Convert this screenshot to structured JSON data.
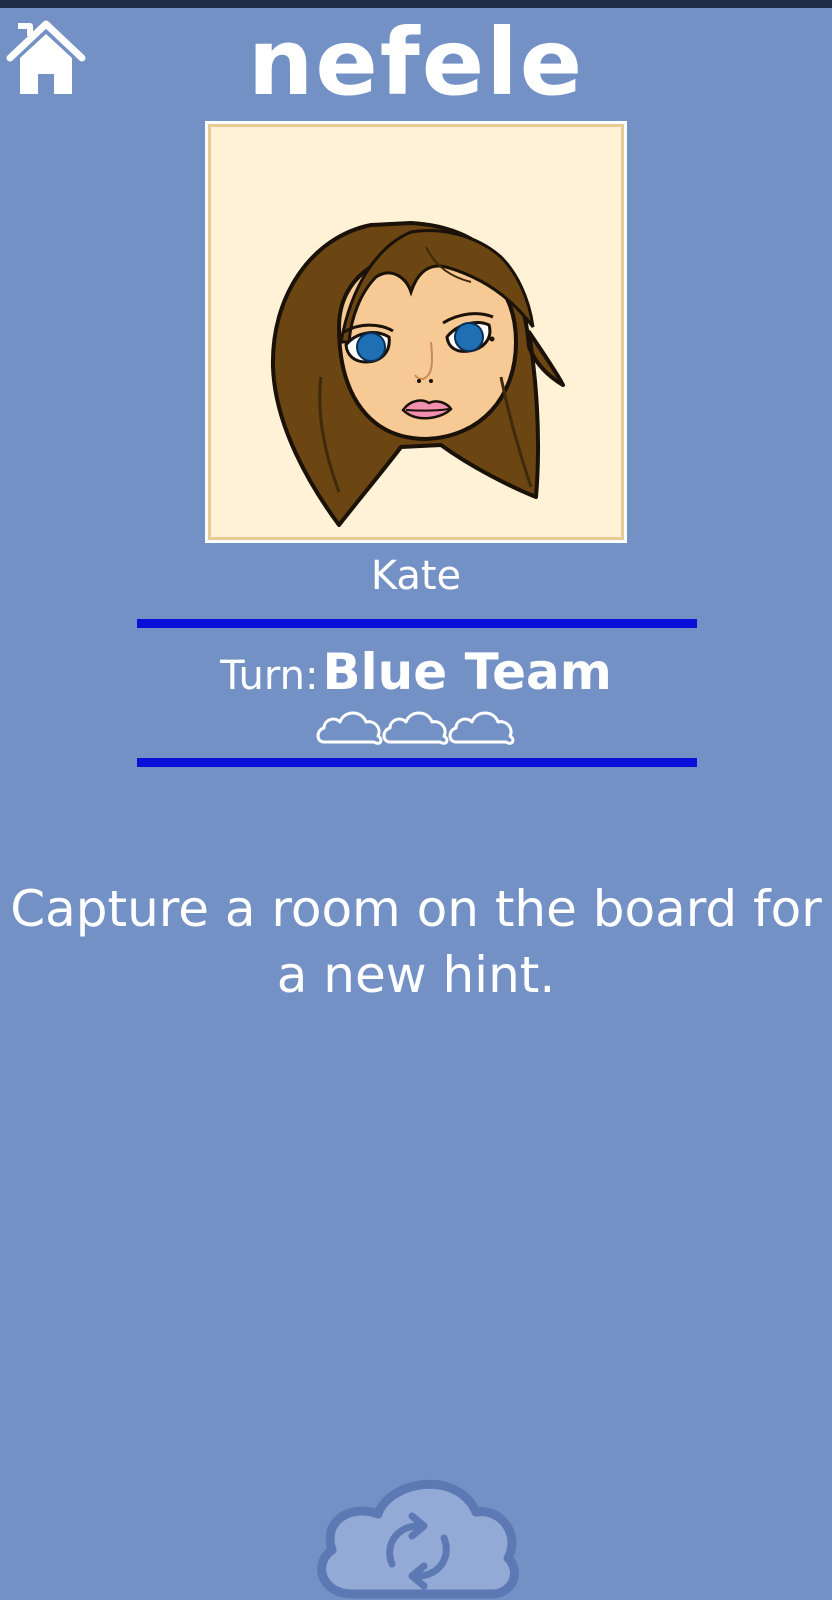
{
  "app": {
    "title": "nefele"
  },
  "header": {
    "home_icon": "home-icon"
  },
  "player": {
    "name": "Kate",
    "avatar_icon": "cartoon-girl-portrait"
  },
  "turn": {
    "label": "Turn:",
    "team": "Blue Team",
    "team_color": "#0a10d8",
    "cloud_tokens": 3
  },
  "message": {
    "text": "Capture a room on the board for a new hint."
  },
  "footer": {
    "refresh_icon": "cloud-refresh-icon"
  },
  "colors": {
    "background": "#7491c6",
    "accent": "#0a10d8",
    "portrait_bg": "#fff2d6"
  }
}
